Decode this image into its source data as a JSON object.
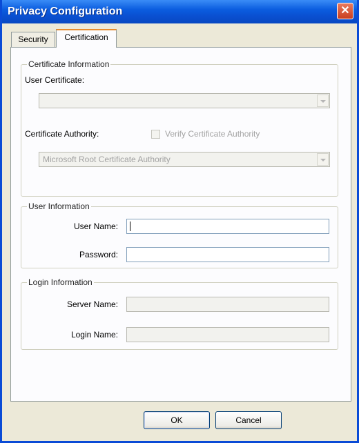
{
  "window": {
    "title": "Privacy Configuration",
    "close_label": "✕"
  },
  "tabs": [
    {
      "label": "Security",
      "active": false
    },
    {
      "label": "Certification",
      "active": true
    }
  ],
  "certificate_info": {
    "legend": "Certificate Information",
    "user_certificate_label": "User Certificate:",
    "user_certificate_value": "",
    "authority_label": "Certificate Authority:",
    "verify_label": "Verify Certificate Authority",
    "verify_checked": false,
    "authority_value": "Microsoft Root Certificate Authority"
  },
  "user_info": {
    "legend": "User Information",
    "username_label": "User Name:",
    "username_value": "",
    "password_label": "Password:",
    "password_value": ""
  },
  "login_info": {
    "legend": "Login Information",
    "server_label": "Server Name:",
    "server_value": "",
    "login_label": "Login Name:",
    "login_value": ""
  },
  "buttons": {
    "ok": "OK",
    "cancel": "Cancel"
  }
}
